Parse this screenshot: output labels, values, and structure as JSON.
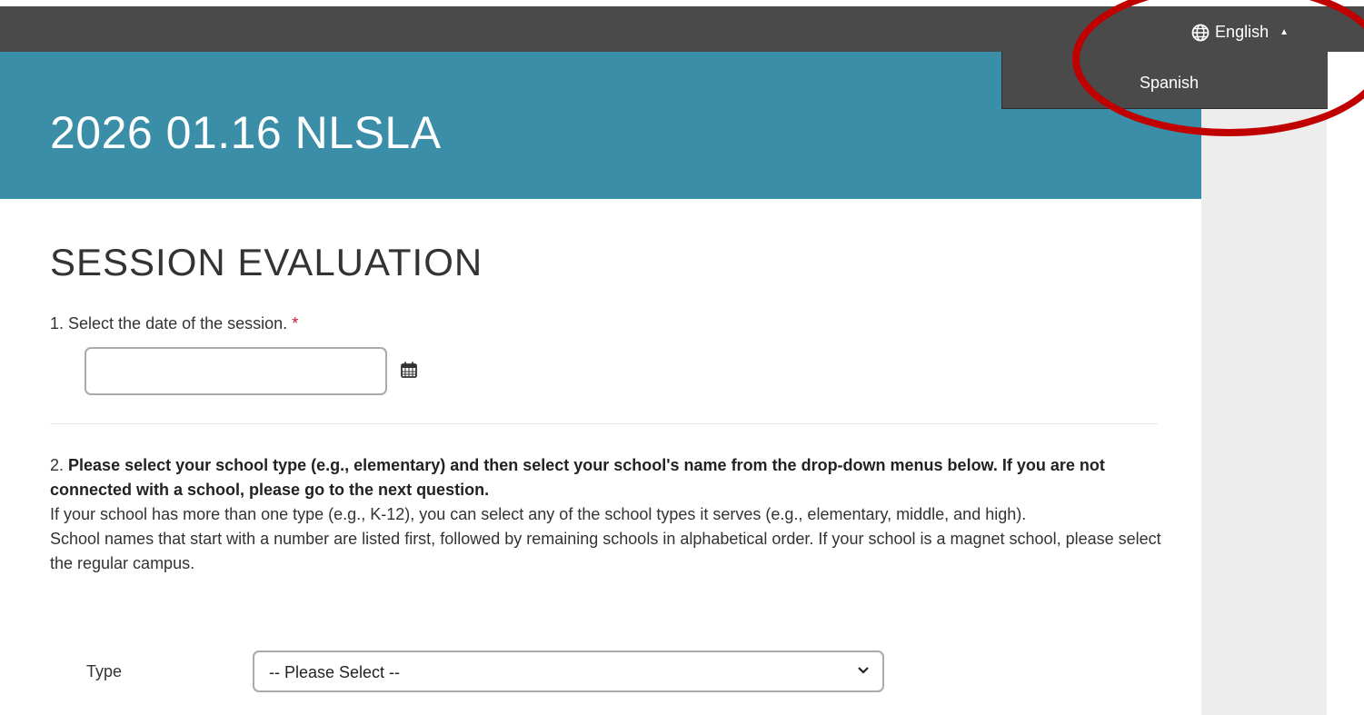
{
  "header": {
    "language_current": "English",
    "language_options": [
      "Spanish"
    ],
    "language_icon": "globe-icon",
    "caret_icon": "caret-up-icon"
  },
  "banner": {
    "title": "2026 01.16 NLSLA"
  },
  "form": {
    "title": "SESSION EVALUATION",
    "q1": {
      "label": "1. Select the date of the session.",
      "required_mark": "*",
      "date_value": "",
      "icon": "calendar-icon"
    },
    "q2": {
      "number": "2.",
      "bold": "Please select your school type (e.g., elementary) and then select your school's name from the drop-down menus below. If you are not connected with a school, please go to the next question.",
      "line2": "If your school has more than one type (e.g., K-12), you can select any of the school types it serves (e.g., elementary, middle, and high).",
      "line3": "School names that start with a number are listed first, followed by remaining schools in alphabetical order. If your school is a magnet school, please select the regular campus.",
      "type_label": "Type",
      "type_selected": "-- Please Select --"
    }
  },
  "colors": {
    "topbar": "#4a4a4a",
    "banner": "#3a8ea8",
    "required": "#c8102e",
    "annotation": "#c00000",
    "gutter": "#ededed"
  }
}
